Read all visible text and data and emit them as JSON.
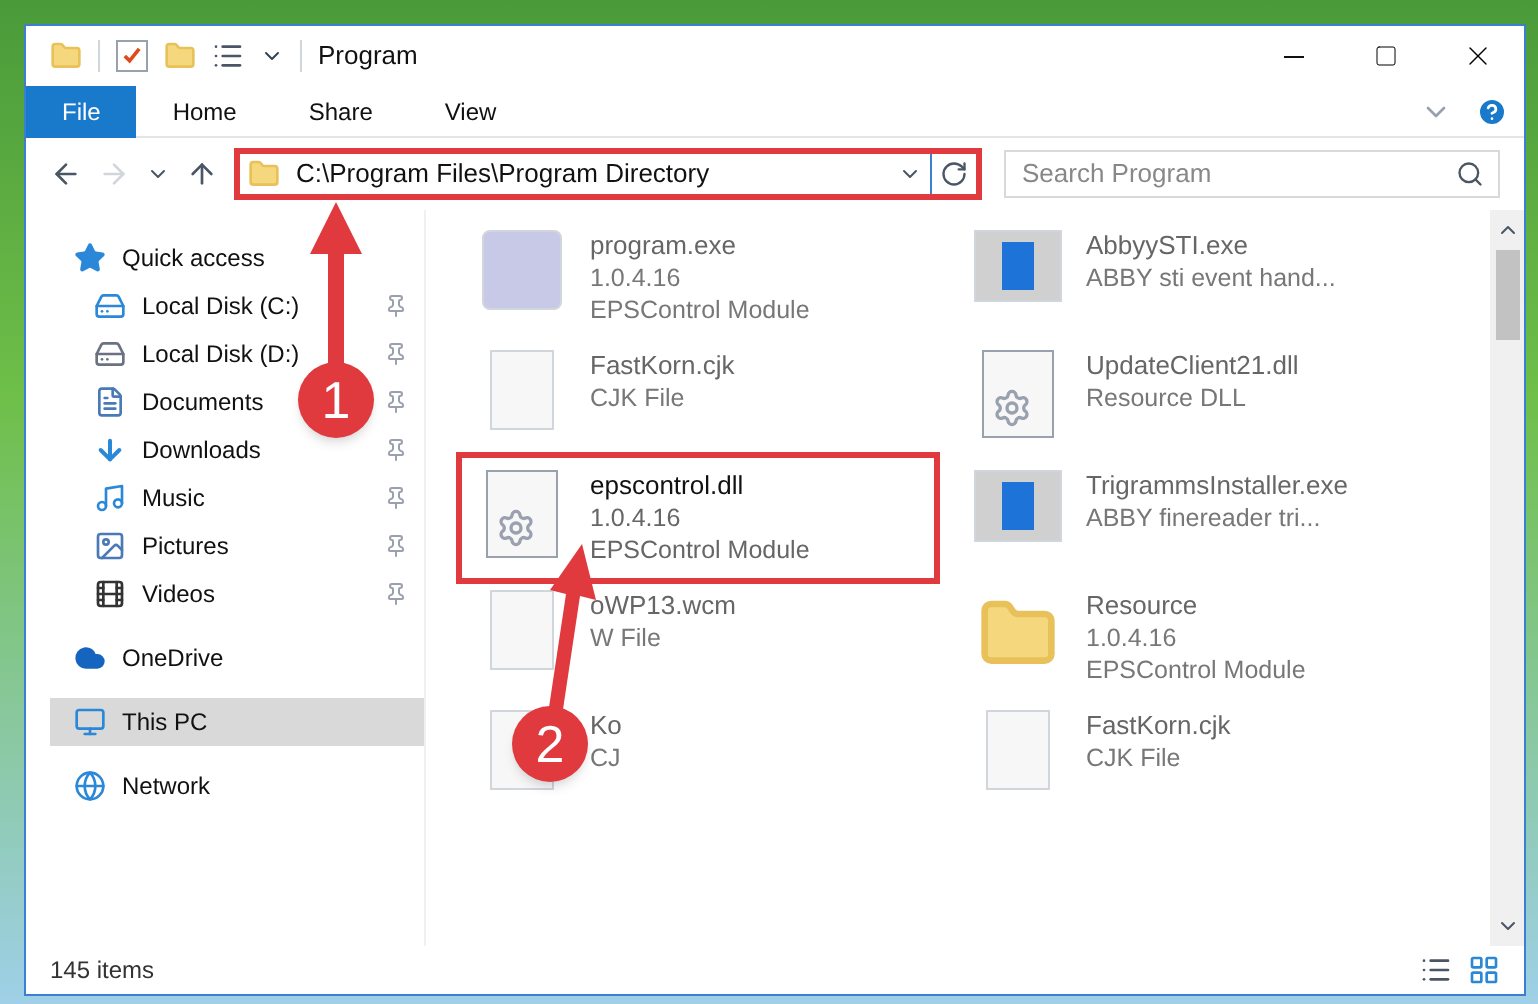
{
  "window": {
    "title": "Program"
  },
  "ribbon_tabs": [
    {
      "label": "File",
      "selected": true
    },
    {
      "label": "Home",
      "selected": false
    },
    {
      "label": "Share",
      "selected": false
    },
    {
      "label": "View",
      "selected": false
    }
  ],
  "address": {
    "path": "C:\\Program Files\\Program Directory",
    "highlighted": true
  },
  "search": {
    "placeholder": "Search Program"
  },
  "sidebar": {
    "items": [
      {
        "label": "Quick access",
        "kind": "star",
        "selected": false,
        "children": [
          {
            "label": "Local Disk (C:)",
            "kind": "system-disk",
            "pinned": true,
            "selected": false
          },
          {
            "label": "Local Disk (D:)",
            "kind": "disk",
            "pinned": true,
            "selected": false
          },
          {
            "label": "Documents",
            "kind": "document",
            "pinned": true,
            "selected": false
          },
          {
            "label": "Downloads",
            "kind": "download",
            "pinned": true,
            "selected": false
          },
          {
            "label": "Music",
            "kind": "music",
            "pinned": true,
            "selected": false
          },
          {
            "label": "Pictures",
            "kind": "picture",
            "pinned": true,
            "selected": false
          },
          {
            "label": "Videos",
            "kind": "video",
            "pinned": true,
            "selected": false
          }
        ]
      },
      {
        "label": "OneDrive",
        "kind": "cloud",
        "selected": false
      },
      {
        "label": "This PC",
        "kind": "pc",
        "selected": true
      },
      {
        "label": "Network",
        "kind": "network",
        "selected": false
      }
    ]
  },
  "files": [
    {
      "name": "program.exe",
      "lines": [
        "1.0.4.16",
        "EPSControl Module"
      ],
      "kind": "exe",
      "highlighted": false
    },
    {
      "name": "AbbyySTI.exe",
      "lines": [
        "ABBY sti event hand..."
      ],
      "kind": "window",
      "highlighted": false
    },
    {
      "name": "FastKorn.cjk",
      "lines": [
        "CJK File"
      ],
      "kind": "blank",
      "highlighted": false
    },
    {
      "name": "UpdateClient21.dll",
      "lines": [
        "Resource DLL"
      ],
      "kind": "dll",
      "highlighted": false
    },
    {
      "name": "epscontrol.dll",
      "lines": [
        "1.0.4.16",
        "EPSControl Module"
      ],
      "kind": "dll",
      "highlighted": true
    },
    {
      "name": "TrigrammsInstaller.exe",
      "lines": [
        "ABBY finereader tri..."
      ],
      "kind": "window",
      "highlighted": false
    },
    {
      "name": "oWP13.wcm",
      "lines": [
        "W File"
      ],
      "kind": "blank",
      "highlighted": false
    },
    {
      "name": "Resource",
      "lines": [
        "1.0.4.16",
        "EPSControl Module"
      ],
      "kind": "folder",
      "highlighted": false
    },
    {
      "name": "Ko",
      "lines": [
        "CJ"
      ],
      "kind": "blank",
      "highlighted": false
    },
    {
      "name": "FastKorn.cjk",
      "lines": [
        "CJK File"
      ],
      "kind": "blank",
      "highlighted": false
    }
  ],
  "callouts": [
    {
      "number": "1"
    },
    {
      "number": "2"
    }
  ],
  "status_bar": {
    "count": "145 items"
  }
}
